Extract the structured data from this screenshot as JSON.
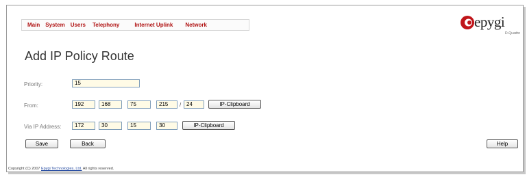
{
  "nav": {
    "items": [
      "Main",
      "System",
      "Users",
      "Telephony",
      "Internet Uplink",
      "Network"
    ]
  },
  "logo": {
    "word": "epygi",
    "sub": "D-Quadro",
    "color": "#c0151a"
  },
  "page": {
    "title": "Add IP Policy Route"
  },
  "form": {
    "priority": {
      "label": "Priority:",
      "value": "15"
    },
    "from": {
      "label": "From:",
      "octets": [
        "192",
        "168",
        "75",
        "215"
      ],
      "separator": "/",
      "mask": "24",
      "clipboard_label": "IP-Clipboard"
    },
    "via": {
      "label": "Via IP Address:",
      "octets": [
        "172",
        "30",
        "15",
        "30"
      ],
      "clipboard_label": "IP-Clipboard"
    }
  },
  "buttons": {
    "save": "Save",
    "back": "Back",
    "help": "Help"
  },
  "footer": {
    "prefix": "Copyright (C) 2007",
    "company": "Epygi Technologies, Ltd.",
    "suffix": "All rights reserved."
  }
}
